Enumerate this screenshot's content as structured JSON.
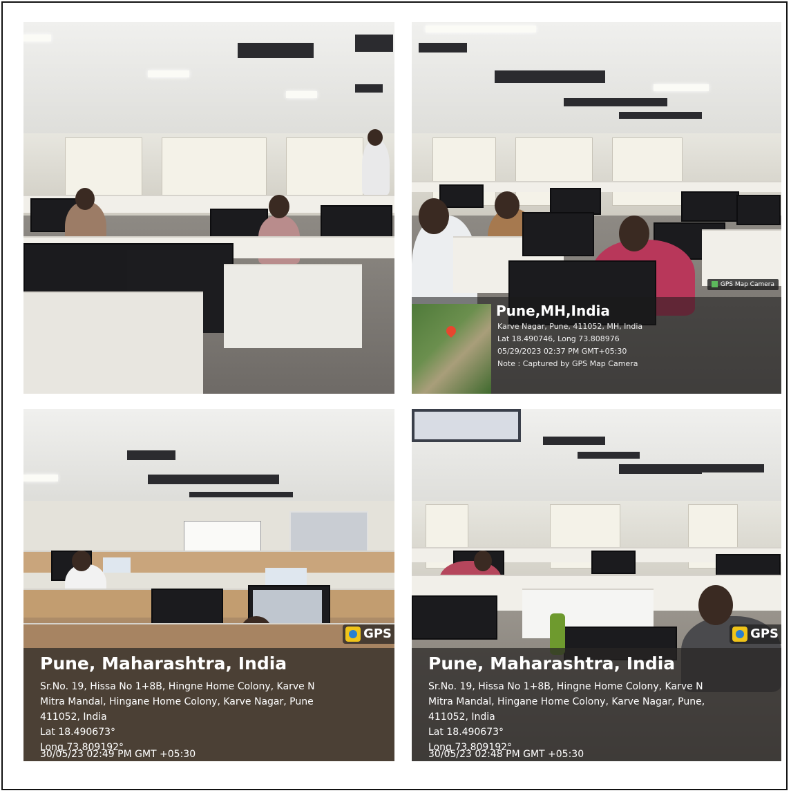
{
  "photos": [
    {
      "id": "top-left"
    },
    {
      "id": "top-right",
      "overlay": {
        "city": "Pune,MH,India",
        "address": "Karve Nagar, Pune, 411052, MH, India",
        "coords": "Lat 18.490746, Long 73.808976",
        "datetime": "05/29/2023 02:37 PM GMT+05:30",
        "note": "Note : Captured by GPS Map Camera",
        "badge": "GPS Map Camera"
      }
    },
    {
      "id": "bottom-left",
      "overlay": {
        "tab": "GPS",
        "city": "Pune, Maharashtra, India",
        "address1": "Sr.No. 19, Hissa No 1+8B, Hingne Home Colony, Karve N",
        "address2": "Mitra Mandal, Hingane Home Colony, Karve Nagar, Pune",
        "address3": "411052, India",
        "lat": "Lat 18.490673°",
        "long": "Long 73.809192°",
        "datetime": "30/05/23 02:49 PM GMT +05:30"
      }
    },
    {
      "id": "bottom-right",
      "overlay": {
        "tab": "GPS",
        "city": "Pune, Maharashtra, India",
        "address1": "Sr.No. 19, Hissa No 1+8B, Hingne Home Colony, Karve N",
        "address2": "Mitra Mandal, Hingane Home Colony, Karve Nagar, Pune,",
        "address3": "411052, India",
        "lat": "Lat 18.490673°",
        "long": "Long 73.809192°",
        "datetime": "30/05/23 02:48 PM GMT +05:30"
      }
    }
  ],
  "icons": {
    "gps_app": "gps-app-icon",
    "map_pin": "map-pin-icon",
    "gps_camera": "gps-camera-icon"
  },
  "colors": {
    "frame_border": "#111111",
    "overlay_text": "#ffffff",
    "gps_icon_yellow": "#f0c419",
    "map_pin_red": "#e8462e"
  }
}
